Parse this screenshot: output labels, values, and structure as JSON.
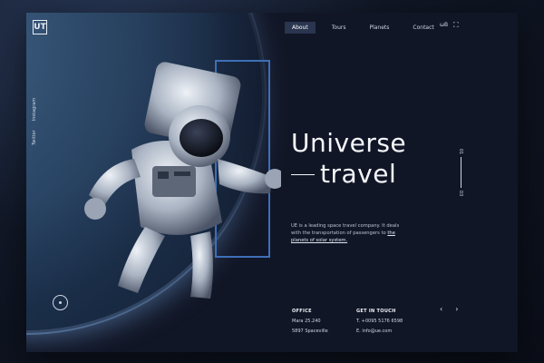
{
  "brand": {
    "logo_text": "UT"
  },
  "nav": {
    "items": [
      {
        "label": "About",
        "active": true
      },
      {
        "label": "Tours",
        "active": false
      },
      {
        "label": "Planets",
        "active": false
      },
      {
        "label": "Contact",
        "active": false
      }
    ],
    "extra_label": "ωB",
    "expand_icon": "fullscreen-icon"
  },
  "social": {
    "items": [
      "Twitter",
      "Instagram"
    ]
  },
  "hero": {
    "title_line1": "Universe",
    "title_line2": "travel",
    "description_plain": "UE is a leading space travel company. It deals with the transportation of passengers to ",
    "description_link": "the planets of solar system."
  },
  "pager": {
    "current": "01",
    "total": "03"
  },
  "footer": {
    "office_heading": "OFFICE",
    "office_line1": "Mara 25.240",
    "office_line2": "5897 Spaceville",
    "touch_heading": "GET IN TOUCH",
    "touch_phone": "T.  +0095 5176 6598",
    "touch_email": "E.  info@ue.com"
  },
  "arrows": {
    "prev": "‹",
    "next": "›"
  },
  "colors": {
    "accent": "#3d6fb8",
    "background": "#111626"
  }
}
